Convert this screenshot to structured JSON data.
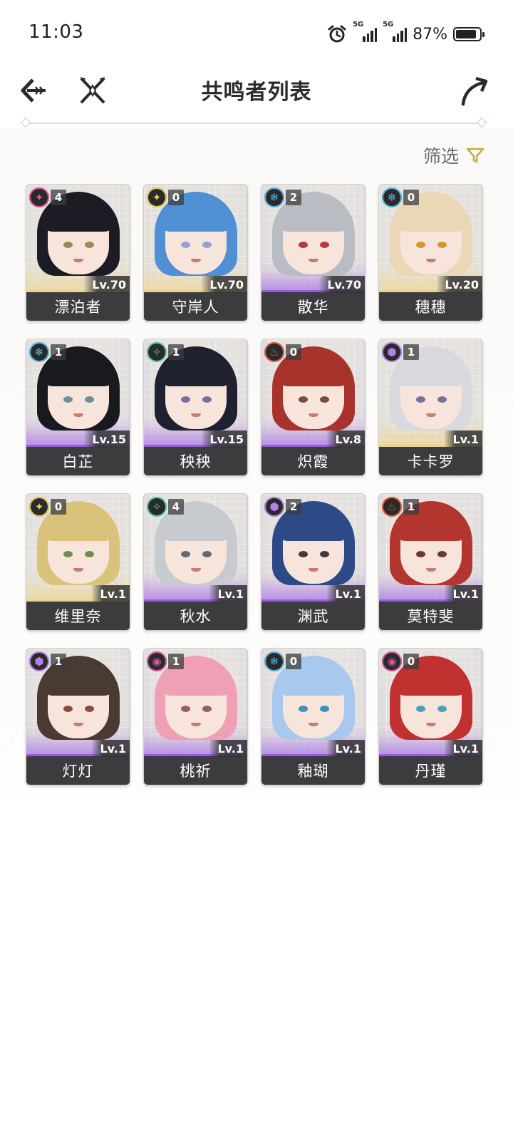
{
  "status": {
    "time": "11:03",
    "net1": "5G",
    "net2": "5G",
    "battery": "87%",
    "battery_level": 0.87
  },
  "header": {
    "title": "共鸣者列表"
  },
  "filter": {
    "label": "筛选"
  },
  "characters": [
    {
      "name": "漂泊者",
      "level": "Lv.70",
      "seq": "4",
      "element": "spectro",
      "element_color": "#e04fa0",
      "hair_color": "#1c1d24",
      "eye_color": "#9b8a55",
      "rarity": "gold"
    },
    {
      "name": "守岸人",
      "level": "Lv.70",
      "seq": "0",
      "element": "spectro",
      "element_color": "#e8cc5a",
      "hair_color": "#4f8fd4",
      "eye_color": "#8fa3d8",
      "rarity": "gold"
    },
    {
      "name": "散华",
      "level": "Lv.70",
      "seq": "2",
      "element": "glacio",
      "element_color": "#58b7e6",
      "hair_color": "#b9bcc3",
      "eye_color": "#b23b3b",
      "rarity": "purple"
    },
    {
      "name": "穗穗",
      "level": "Lv.20",
      "seq": "0",
      "element": "glacio",
      "element_color": "#58b7e6",
      "hair_color": "#ead7b6",
      "eye_color": "#d7962c",
      "rarity": "gold"
    },
    {
      "name": "白芷",
      "level": "Lv.15",
      "seq": "1",
      "element": "glacio",
      "element_color": "#58b7e6",
      "hair_color": "#191a1f",
      "eye_color": "#6a8fa0",
      "rarity": "purple"
    },
    {
      "name": "秧秧",
      "level": "Lv.15",
      "seq": "1",
      "element": "aero",
      "element_color": "#4fd3a2",
      "hair_color": "#1f2030",
      "eye_color": "#7a6ea0",
      "rarity": "purple"
    },
    {
      "name": "炽霞",
      "level": "Lv.8",
      "seq": "0",
      "element": "fusion",
      "element_color": "#ef5b3a",
      "hair_color": "#a8332c",
      "eye_color": "#7b4a3a",
      "rarity": "purple"
    },
    {
      "name": "卡卡罗",
      "level": "Lv.1",
      "seq": "1",
      "element": "electro",
      "element_color": "#b47ef0",
      "hair_color": "#d7d9de",
      "eye_color": "#7a6e9a",
      "rarity": "gold"
    },
    {
      "name": "维里奈",
      "level": "Lv.1",
      "seq": "0",
      "element": "spectro",
      "element_color": "#e8cc5a",
      "hair_color": "#d9c27a",
      "eye_color": "#6d8f4e",
      "rarity": "gold"
    },
    {
      "name": "秋水",
      "level": "Lv.1",
      "seq": "4",
      "element": "aero",
      "element_color": "#4fd3a2",
      "hair_color": "#c7cacf",
      "eye_color": "#5e6a7a",
      "rarity": "purple"
    },
    {
      "name": "渊武",
      "level": "Lv.1",
      "seq": "2",
      "element": "electro",
      "element_color": "#b47ef0",
      "hair_color": "#2e4a86",
      "eye_color": "#3c3c44",
      "rarity": "purple"
    },
    {
      "name": "莫特斐",
      "level": "Lv.1",
      "seq": "1",
      "element": "fusion",
      "element_color": "#ef5b3a",
      "hair_color": "#b2362e",
      "eye_color": "#6b3a2a",
      "rarity": "purple"
    },
    {
      "name": "灯灯",
      "level": "Lv.1",
      "seq": "1",
      "element": "electro",
      "element_color": "#b47ef0",
      "hair_color": "#4a3a34",
      "eye_color": "#8b4a3a",
      "rarity": "purple"
    },
    {
      "name": "桃祈",
      "level": "Lv.1",
      "seq": "1",
      "element": "havoc",
      "element_color": "#d05aa3",
      "hair_color": "#f0a0b4",
      "eye_color": "#9a5a6a",
      "rarity": "purple"
    },
    {
      "name": "釉瑚",
      "level": "Lv.1",
      "seq": "0",
      "element": "glacio",
      "element_color": "#58b7e6",
      "hair_color": "#a9c8ee",
      "eye_color": "#3f8fc2",
      "rarity": "purple"
    },
    {
      "name": "丹瑾",
      "level": "Lv.1",
      "seq": "0",
      "element": "havoc",
      "element_color": "#d05aa3",
      "hair_color": "#c0312f",
      "eye_color": "#4aa3b5",
      "rarity": "purple"
    }
  ]
}
